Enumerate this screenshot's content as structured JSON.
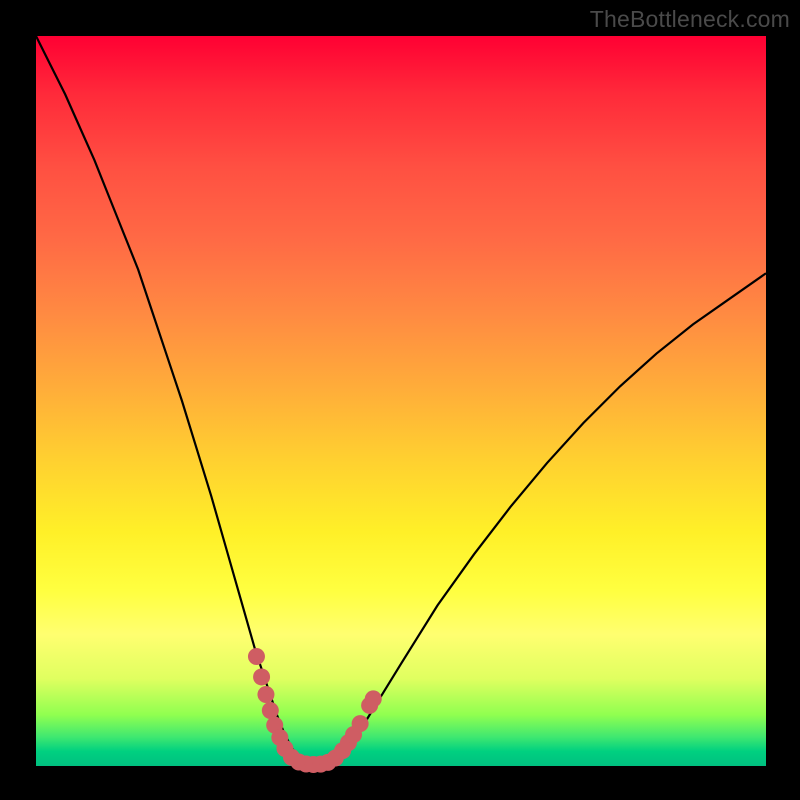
{
  "watermark": "TheBottleneck.com",
  "chart_data": {
    "type": "line",
    "title": "",
    "xlabel": "",
    "ylabel": "",
    "xlim": [
      0,
      100
    ],
    "ylim": [
      0,
      100
    ],
    "series": [
      {
        "name": "bottleneck-curve",
        "x": [
          0,
          2,
          4,
          6,
          8,
          10,
          12,
          14,
          16,
          18,
          20,
          22,
          24,
          26,
          28,
          30,
          32,
          33,
          34,
          35,
          36,
          37,
          38,
          39,
          40,
          41,
          42,
          44,
          46,
          50,
          55,
          60,
          65,
          70,
          75,
          80,
          85,
          90,
          95,
          100
        ],
        "y": [
          100,
          96,
          92,
          87.5,
          83,
          78,
          73,
          68,
          62,
          56,
          50,
          43.5,
          37,
          30,
          23,
          16,
          10,
          7,
          4.5,
          2.5,
          1.3,
          0.6,
          0.3,
          0.2,
          0.3,
          0.7,
          1.6,
          4.2,
          7.5,
          14,
          22,
          29,
          35.5,
          41.5,
          47,
          52,
          56.5,
          60.5,
          64,
          67.5
        ]
      }
    ],
    "markers": {
      "name": "highlight-dots",
      "color": "#cf5d63",
      "points": [
        {
          "x": 30.2,
          "y": 15
        },
        {
          "x": 30.9,
          "y": 12.2
        },
        {
          "x": 31.5,
          "y": 9.8
        },
        {
          "x": 32.1,
          "y": 7.6
        },
        {
          "x": 32.7,
          "y": 5.6
        },
        {
          "x": 33.4,
          "y": 3.9
        },
        {
          "x": 34.1,
          "y": 2.4
        },
        {
          "x": 35,
          "y": 1.2
        },
        {
          "x": 36,
          "y": 0.55
        },
        {
          "x": 37,
          "y": 0.28
        },
        {
          "x": 38,
          "y": 0.2
        },
        {
          "x": 39,
          "y": 0.26
        },
        {
          "x": 40,
          "y": 0.5
        },
        {
          "x": 41,
          "y": 1.1
        },
        {
          "x": 42,
          "y": 2.1
        },
        {
          "x": 42.8,
          "y": 3.2
        },
        {
          "x": 43.5,
          "y": 4.3
        },
        {
          "x": 44.4,
          "y": 5.8
        },
        {
          "x": 45.7,
          "y": 8.3
        },
        {
          "x": 46.2,
          "y": 9.2
        }
      ]
    }
  }
}
